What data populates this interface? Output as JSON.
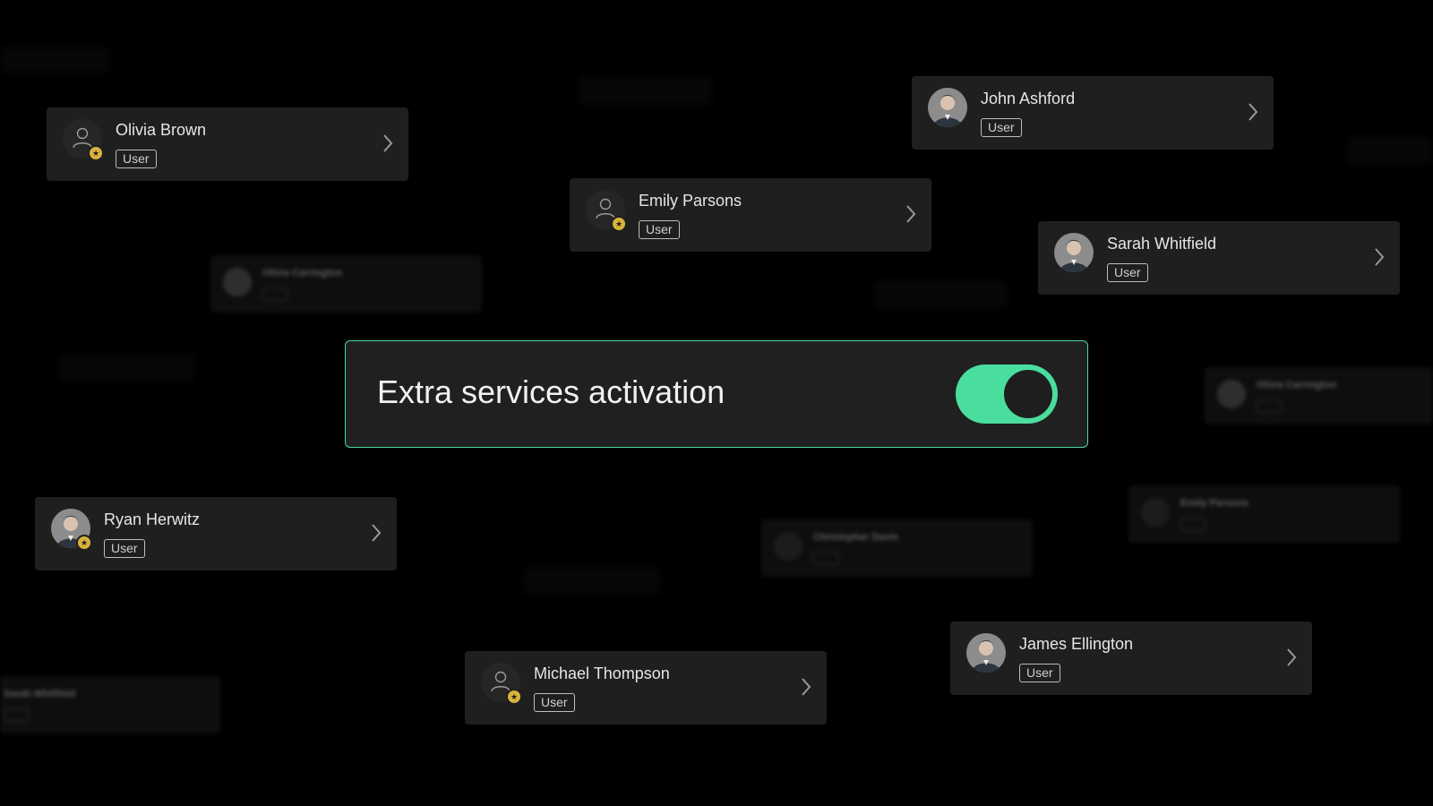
{
  "colors": {
    "accent": "#4ade9e",
    "card_bg": "#1f1f1f",
    "star": "#d8b33c",
    "background": "#000000"
  },
  "activation": {
    "label": "Extra services activation",
    "toggle_on": true
  },
  "users": [
    {
      "name": "Olivia Brown",
      "role": "User",
      "avatar": "placeholder-user-icon",
      "starred": true
    },
    {
      "name": "John Ashford",
      "role": "User",
      "avatar": "photo",
      "starred": false
    },
    {
      "name": "Emily Parsons",
      "role": "User",
      "avatar": "placeholder-user-icon",
      "starred": true
    },
    {
      "name": "Sarah Whitfield",
      "role": "User",
      "avatar": "photo",
      "starred": false
    },
    {
      "name": "Ryan Herwitz",
      "role": "User",
      "avatar": "photo",
      "starred": true
    },
    {
      "name": "Michael Thompson",
      "role": "User",
      "avatar": "placeholder-user-icon",
      "starred": true
    },
    {
      "name": "James Ellington",
      "role": "User",
      "avatar": "photo",
      "starred": false
    }
  ],
  "background_users": [
    {
      "name": "Olivia Carrington",
      "role": "User"
    },
    {
      "name": "Olivia Carrington",
      "role": "User"
    },
    {
      "name": "Emily Parsons",
      "role": "User"
    },
    {
      "name": "Christopher Davis",
      "role": "User"
    },
    {
      "name": "Sarah Whitfield",
      "role": "User"
    }
  ]
}
